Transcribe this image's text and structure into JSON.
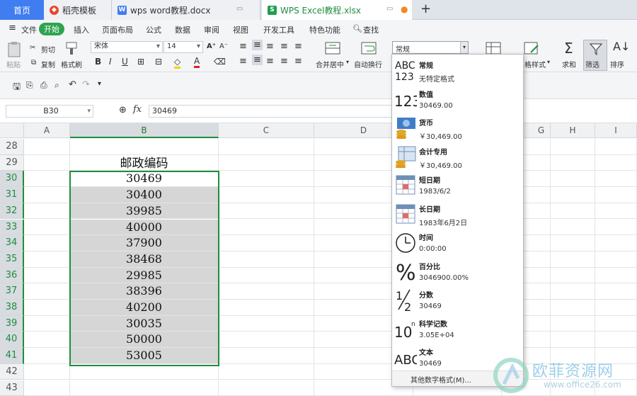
{
  "tabs": [
    {
      "label": "首页"
    },
    {
      "label": "稻壳模板"
    },
    {
      "label": "wps word教程.docx"
    },
    {
      "label": "WPS Excel教程.xlsx"
    }
  ],
  "tab_add": "+",
  "menu": {
    "file": "文件",
    "items": [
      "开始",
      "插入",
      "页面布局",
      "公式",
      "数据",
      "审阅",
      "视图",
      "开发工具",
      "特色功能"
    ],
    "search": "查找"
  },
  "ribbon": {
    "paste": "粘贴",
    "cut": "剪切",
    "copy": "复制",
    "format_painter": "格式刷",
    "font": "宋体",
    "size": "14",
    "merge": "合并居中",
    "wrap": "自动换行",
    "styles": "格样式",
    "sum": "求和",
    "filter": "筛选",
    "sort": "排序",
    "bold": "B",
    "italic": "I",
    "underline": "U",
    "font_color": "A"
  },
  "formula": {
    "cell_ref": "B30",
    "fx": "fx",
    "value": "30469"
  },
  "columns": [
    "A",
    "B",
    "C",
    "D",
    "E",
    "F",
    "G",
    "H",
    "I"
  ],
  "rows": [
    "28",
    "29",
    "30",
    "31",
    "32",
    "33",
    "34",
    "35",
    "36",
    "37",
    "38",
    "39",
    "40",
    "41",
    "42",
    "43"
  ],
  "header_cell": "邮政编码",
  "values": [
    "30469",
    "30400",
    "39985",
    "40000",
    "37900",
    "38468",
    "29985",
    "38396",
    "40200",
    "30035",
    "50000",
    "53005"
  ],
  "number_format": {
    "current": "常规",
    "options": [
      {
        "name": "常规",
        "preview": "无特定格式",
        "icon": "abc-123-icon"
      },
      {
        "name": "数值",
        "preview": "30469.00",
        "icon": "number-123-icon"
      },
      {
        "name": "货币",
        "preview": "￥30,469.00",
        "icon": "currency-coins-icon"
      },
      {
        "name": "会计专用",
        "preview": "￥30,469.00",
        "icon": "accounting-coins-icon"
      },
      {
        "name": "短日期",
        "preview": "1983/6/2",
        "icon": "calendar-icon"
      },
      {
        "name": "长日期",
        "preview": "1983年6月2日",
        "icon": "calendar-icon"
      },
      {
        "name": "时间",
        "preview": "0:00:00",
        "icon": "clock-icon"
      },
      {
        "name": "百分比",
        "preview": "3046900.00%",
        "icon": "percent-icon"
      },
      {
        "name": "分数",
        "preview": "30469",
        "icon": "fraction-icon"
      },
      {
        "name": "科学记数",
        "preview": "3.05E+04",
        "icon": "scientific-icon"
      },
      {
        "name": "文本",
        "preview": "30469",
        "icon": "text-abc-icon"
      }
    ],
    "more": "其他数字格式(M)..."
  },
  "watermark": {
    "text": "欧菲资源网",
    "url": "www.office26.com"
  }
}
